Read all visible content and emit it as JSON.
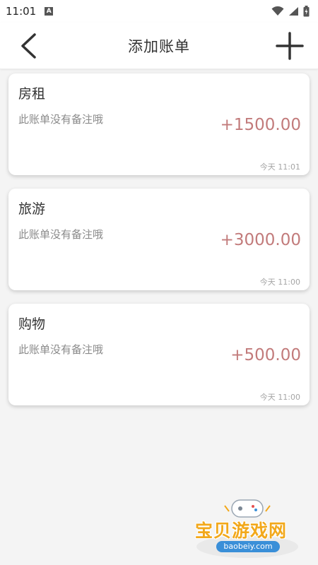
{
  "status_bar": {
    "time": "11:01",
    "a_badge": "A",
    "icons": [
      "wifi-icon",
      "signal-icon",
      "battery-icon"
    ]
  },
  "app_bar": {
    "title": "添加账单",
    "back_icon": "chevron-left-icon",
    "add_icon": "plus-icon"
  },
  "bills": [
    {
      "title": "房租",
      "note": "此账单没有备注哦",
      "amount": "+1500.00",
      "time": "今天 11:01"
    },
    {
      "title": "旅游",
      "note": "此账单没有备注哦",
      "amount": "+3000.00",
      "time": "今天 11:00"
    },
    {
      "title": "购物",
      "note": "此账单没有备注哦",
      "amount": "+500.00",
      "time": "今天 11:00"
    }
  ],
  "watermark": {
    "text": "宝贝游戏网",
    "url": "baobeiy.com"
  },
  "colors": {
    "amount": "#c27b7b",
    "background": "#f4f4f4",
    "card": "#ffffff"
  }
}
